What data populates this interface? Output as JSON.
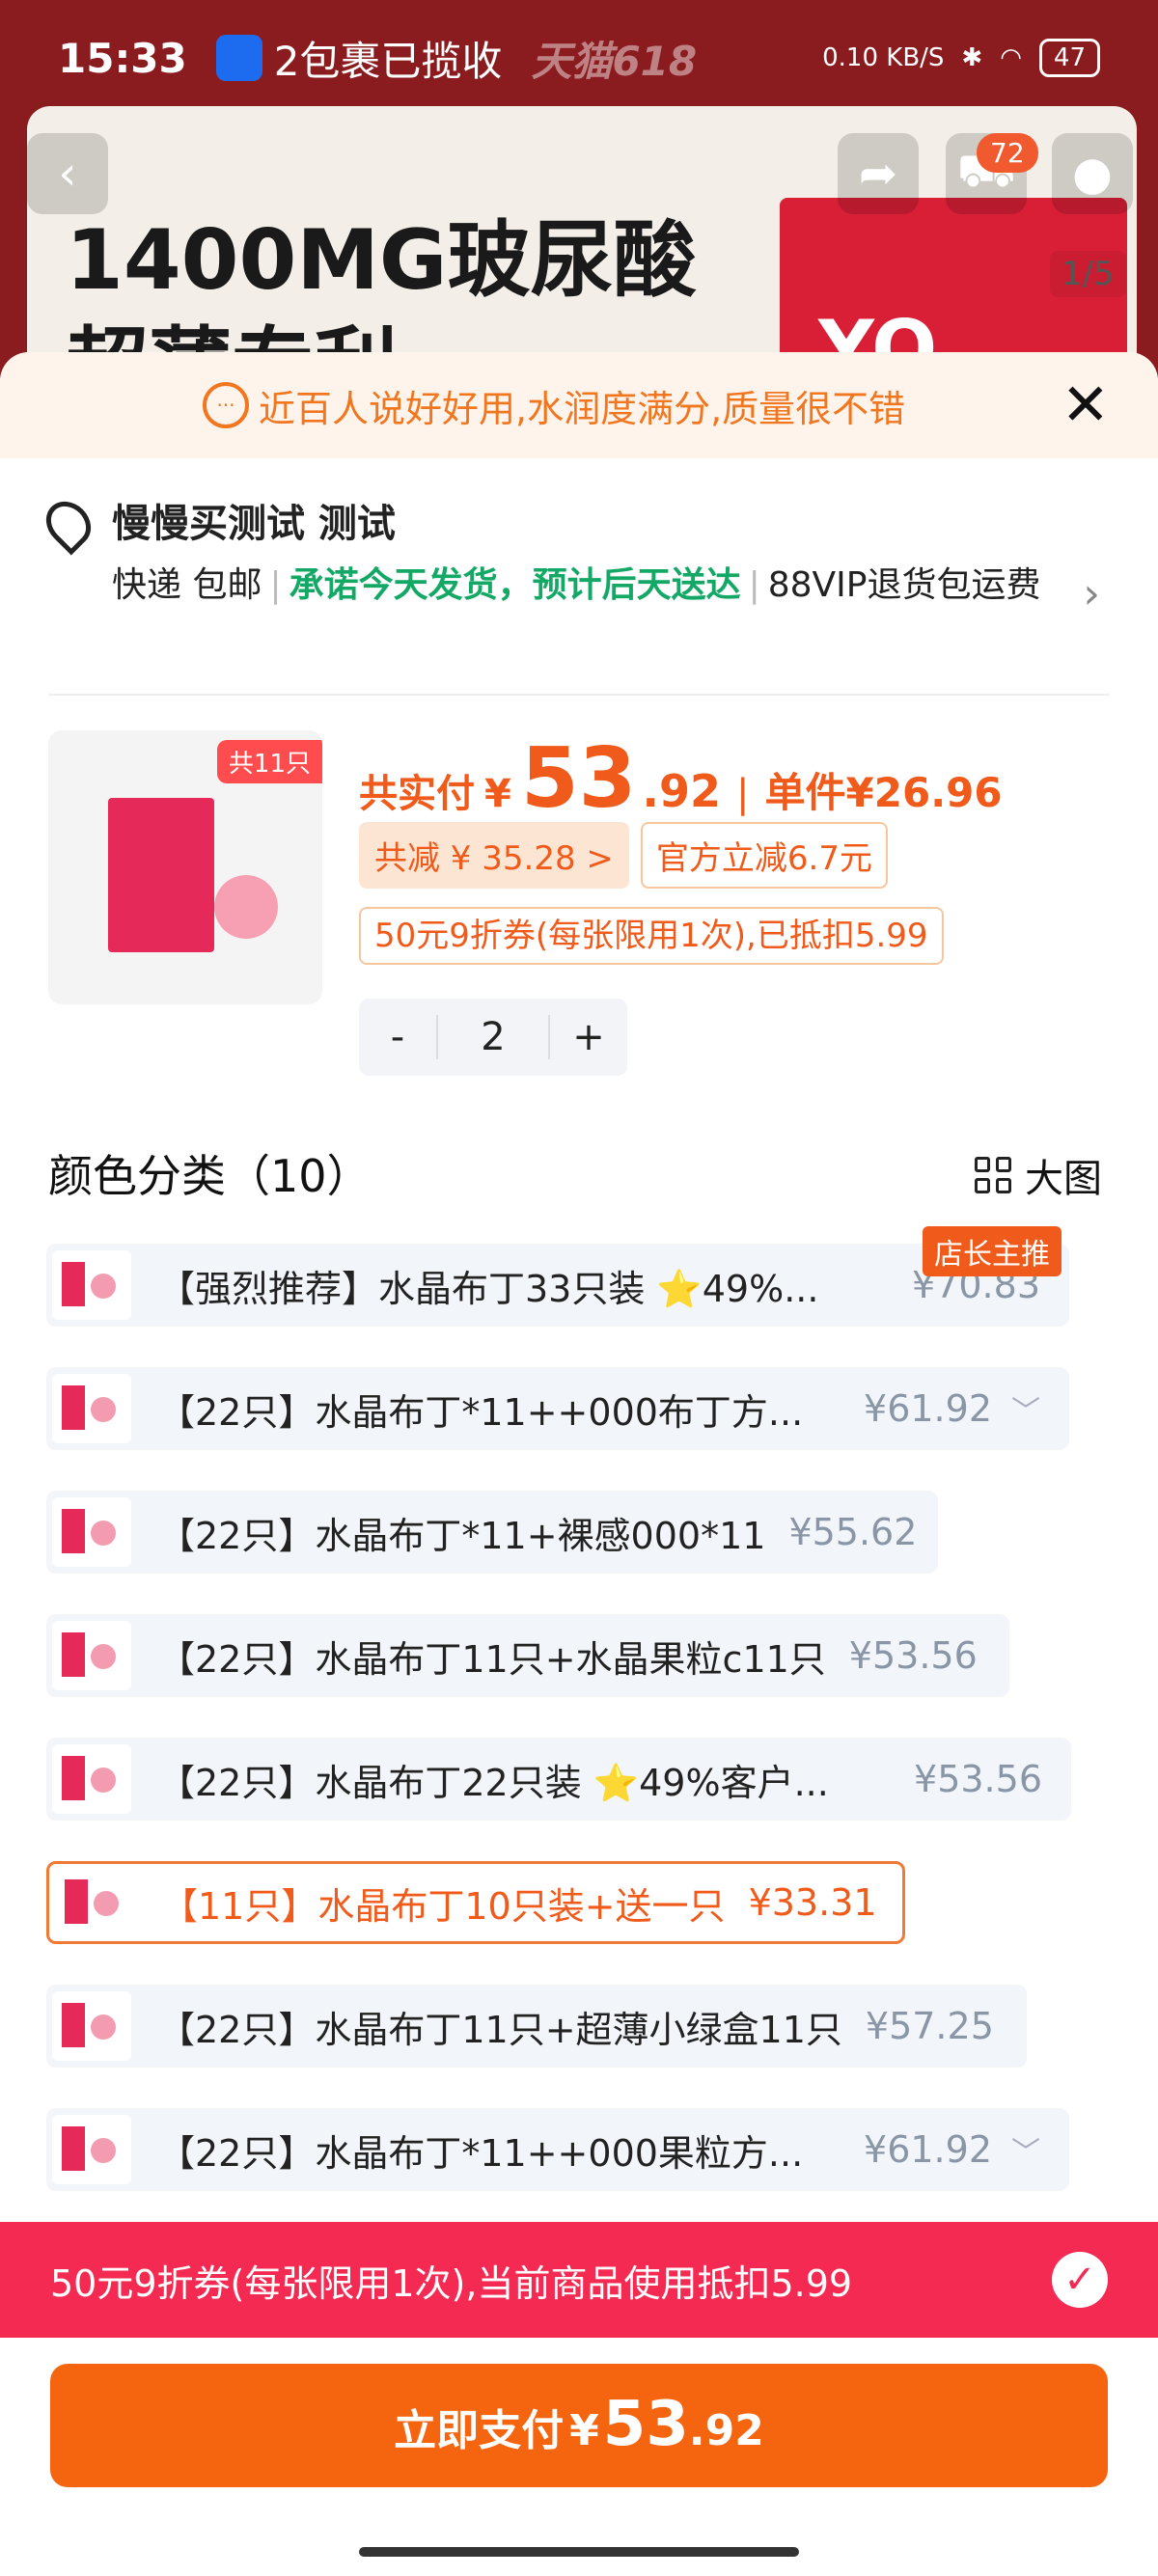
{
  "status": {
    "time": "15:33",
    "notification": "2包裹已揽收",
    "faded_text": "天猫618",
    "net": "0.10 KB/S",
    "battery": "47"
  },
  "banner": {
    "headline_1": "1400MG玻尿酸",
    "headline_2": "超薄专利",
    "box_text": "YO",
    "cart_count": "72",
    "pager": "1/5"
  },
  "tip": {
    "text": "近百人说好好用,水润度满分,质量很不错"
  },
  "address": {
    "name": "慢慢买测试 测试",
    "shipping_1": "快递 包邮",
    "shipping_2": "承诺今天发货，预计后天送达",
    "shipping_3": "88VIP退货包运费"
  },
  "product": {
    "badge": "共11只",
    "total_label": "共实付",
    "currency": "¥",
    "total_int": "53",
    "total_dec": ".92",
    "unit_label": "单件",
    "unit_price": "¥26.96",
    "discount_chip": "共减 ¥ 35.28 >",
    "official_chip": "官方立减6.7元",
    "coupon_chip": "50元9折券(每张限用1次),已抵扣5.99",
    "qty": "2",
    "minus": "-",
    "plus": "+"
  },
  "section": {
    "title": "颜色分类（10）",
    "big_view": "大图"
  },
  "options": [
    {
      "label": "【强烈推荐】水晶布丁33只装 ⭐49%...",
      "price": "¥70.83",
      "tag": "店长主推"
    },
    {
      "label": "【22只】水晶布丁*11++000布丁方...",
      "price": "¥61.92"
    },
    {
      "label": "【22只】水晶布丁*11+裸感000*11",
      "price": "¥55.62"
    },
    {
      "label": "【22只】水晶布丁11只+水晶果粒c11只",
      "price": "¥53.56"
    },
    {
      "label": "【22只】水晶布丁22只装 ⭐49%客户...",
      "price": "¥53.56"
    },
    {
      "label": "【11只】水晶布丁10只装+送一只",
      "price": "¥33.31"
    },
    {
      "label": "【22只】水晶布丁11只+超薄小绿盒11只",
      "price": "¥57.25"
    },
    {
      "label": "【22只】水晶布丁*11++000果粒方...",
      "price": "¥61.92"
    }
  ],
  "coupon_bar": {
    "text": "50元9折券(每张限用1次),当前商品使用抵扣5.99"
  },
  "pay": {
    "label": "立即支付",
    "currency": "¥",
    "int": "53",
    "dec": ".92"
  },
  "colors": {
    "accent": "#f05a1a",
    "coupon_bar": "#f52a52",
    "shipping_green": "#14a866"
  }
}
